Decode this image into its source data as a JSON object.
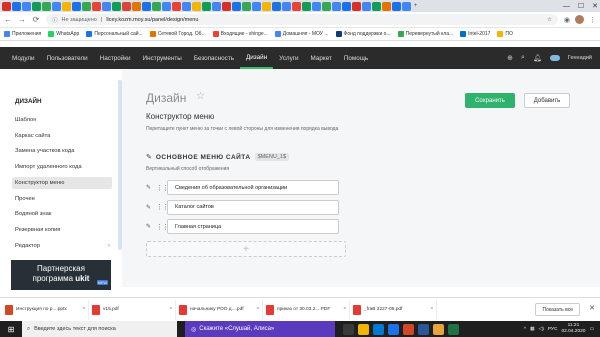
{
  "browser": {
    "tab_colors": [
      "#d93025",
      "#1a73e8",
      "#4285f4",
      "#0f9d58",
      "#34a853",
      "#4285f4",
      "#f4b400",
      "#1a73e8",
      "#34a853",
      "#ea4335",
      "#4285f4",
      "#0f9d58",
      "#db4437",
      "#e37400",
      "#1a73e8",
      "#34a853",
      "#4285f4",
      "#ea4335",
      "#4285f4",
      "#f4b400",
      "#0f9d58",
      "#4285f4",
      "#d93025",
      "#1a73e8",
      "#34a853",
      "#4285f4",
      "#f4b400",
      "#1a73e8",
      "#4285f4",
      "#ea4335",
      "#0f9d58",
      "#4285f4",
      "#34a853",
      "#4285f4",
      "#1a73e8",
      "#d93025",
      "#4285f4",
      "#0f9d58",
      "#e37400",
      "#1a73e8",
      "#4285f4"
    ],
    "new_tab": "+",
    "window": {
      "minimize": "—",
      "maximize": "☐",
      "close": "✕"
    },
    "security": "Не защищено",
    "url": "licey.kozm.moy.su/panel/design/menu",
    "bookmarks": [
      {
        "label": "Приложения",
        "color": "#4285f4"
      },
      {
        "label": "WhatsApp",
        "color": "#25d366"
      },
      {
        "label": "Персональный сай...",
        "color": "#1a73e8"
      },
      {
        "label": "Сетевой Город. Об...",
        "color": "#e37400"
      },
      {
        "label": "Входящие - shinge...",
        "color": "#ea4335"
      },
      {
        "label": "Домашняя - МОУ ...",
        "color": "#4285f4"
      },
      {
        "label": "Фонд поддержки о...",
        "color": "#0f3c7d"
      },
      {
        "label": "Перевернутый кла...",
        "color": "#34a853"
      },
      {
        "label": "Intel-2017",
        "color": "#0071c5"
      },
      {
        "label": "ПО",
        "color": "#f4b400"
      }
    ]
  },
  "site_nav": {
    "items": [
      "Модули",
      "Пользователи",
      "Настройки",
      "Инструменты",
      "Безопасность",
      "Дизайн",
      "Услуги",
      "Маркет",
      "Помощь"
    ],
    "active_index": 5,
    "user": "Геннадий"
  },
  "sidebar": {
    "heading": "ДИЗАЙН",
    "items": [
      {
        "label": "Шаблон",
        "chevron": false
      },
      {
        "label": "Каркас сайта",
        "chevron": false
      },
      {
        "label": "Замена участков кода",
        "chevron": false
      },
      {
        "label": "Импорт удаленного кода",
        "chevron": false
      },
      {
        "label": "Конструктор меню",
        "chevron": false
      },
      {
        "label": "Прочее",
        "chevron": false
      },
      {
        "label": "Водяной знак",
        "chevron": false
      },
      {
        "label": "Резервная копия",
        "chevron": false
      },
      {
        "label": "Редактор",
        "chevron": true
      }
    ],
    "active_index": 4,
    "chevron": "›",
    "partner": {
      "line1": "Партнерская",
      "line2": "программа",
      "brand": "ukit",
      "badge": "NEW"
    }
  },
  "main": {
    "title": "Дизайн",
    "star": "☆",
    "save_label": "Сохранить",
    "add_label": "Добавить",
    "section_title": "Конструктор меню",
    "section_hint": "Перетащите пункт меню за точки с левой стороны для изменения порядка вывода",
    "menu_name": "ОСНОВНОЕ МЕНЮ САЙТА",
    "menu_code": "$MENU_1$",
    "menu_mode": "Вертикальный способ отображения",
    "menu_items": [
      "Сведения об образовательной организации",
      "Каталог сайтов",
      "Главная страница"
    ],
    "add_symbol": "+"
  },
  "downloads": {
    "items": [
      {
        "name": "Инструкция по р....pptx",
        "color": "#d24726"
      },
      {
        "name": "v15.pdf",
        "color": "#e53935"
      },
      {
        "name": "начальнику РОО д....pdf",
        "color": "#e53935"
      },
      {
        "name": "приказ от 30.03.2....PDF",
        "color": "#e53935"
      },
      {
        "name": "_fraB 3227-05.pdf",
        "color": "#e53935"
      }
    ],
    "caret": "^",
    "show_all": "Показать все",
    "close": "✕"
  },
  "taskbar": {
    "search_placeholder": "Введите здесь текст для поиска",
    "alice": "Скажите «Слушай, Алиса»",
    "apps": [
      {
        "color": "#3a3a3a"
      },
      {
        "color": "#f2b600"
      },
      {
        "color": "#0078d4"
      },
      {
        "color": "#1a73e8"
      },
      {
        "color": "#d24726"
      },
      {
        "color": "#2b579a"
      },
      {
        "color": "#e8a33d"
      },
      {
        "color": "#217346"
      }
    ],
    "lang": "РУС",
    "time": "11:21",
    "date": "02.04.2020"
  }
}
